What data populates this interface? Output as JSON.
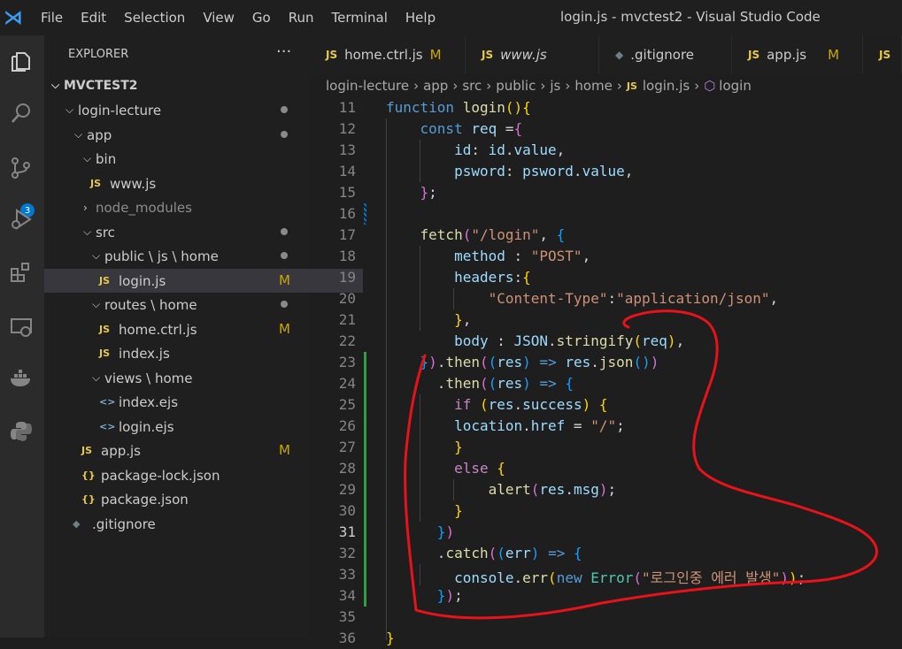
{
  "titlebar": {
    "menu": [
      "File",
      "Edit",
      "Selection",
      "View",
      "Go",
      "Run",
      "Terminal",
      "Help"
    ],
    "title": "login.js - mvctest2 - Visual Studio Code"
  },
  "activity": {
    "items": [
      "explorer-icon",
      "search-icon",
      "source-control-icon",
      "run-debug-icon",
      "extensions-icon",
      "remote-explorer-icon",
      "docker-icon",
      "python-icon"
    ],
    "source_control_badge": "3"
  },
  "explorer": {
    "title": "EXPLORER",
    "more": "···",
    "tree": [
      {
        "label": "MVCTEST2",
        "twisty": "⌵"
      },
      {
        "label": "login-lecture",
        "twisty": "⌵"
      },
      {
        "label": "app",
        "twisty": "⌵"
      },
      {
        "label": "bin",
        "twisty": "⌵"
      },
      {
        "label": "www.js",
        "icon": "JS"
      },
      {
        "label": "node_modules",
        "twisty": "›"
      },
      {
        "label": "src",
        "twisty": "⌵"
      },
      {
        "label": "public \\ js \\ home",
        "twisty": "⌵"
      },
      {
        "label": "login.js",
        "icon": "JS",
        "status": "M"
      },
      {
        "label": "routes \\ home",
        "twisty": "⌵"
      },
      {
        "label": "home.ctrl.js",
        "icon": "JS",
        "status": "M"
      },
      {
        "label": "index.js",
        "icon": "JS"
      },
      {
        "label": "views \\ home",
        "twisty": "⌵"
      },
      {
        "label": "index.ejs",
        "icon": "<>"
      },
      {
        "label": "login.ejs",
        "icon": "<>"
      },
      {
        "label": "app.js",
        "icon": "JS",
        "status": "M"
      },
      {
        "label": "package-lock.json",
        "icon": "{}"
      },
      {
        "label": "package.json",
        "icon": "{}"
      },
      {
        "label": ".gitignore",
        "icon": "◆"
      }
    ]
  },
  "tabs": [
    {
      "label": "home.ctrl.js",
      "icon": "JS",
      "status": "M"
    },
    {
      "label": "www.js",
      "icon": "JS"
    },
    {
      "label": ".gitignore",
      "icon": "◆"
    },
    {
      "label": "app.js",
      "icon": "JS",
      "status": "M"
    },
    {
      "label": "",
      "icon": "JS"
    }
  ],
  "breadcrumb": [
    "login-lecture",
    "app",
    "src",
    "public",
    "js",
    "home",
    "login.js",
    "login"
  ],
  "editor": {
    "line_numbers": [
      "11",
      "12",
      "13",
      "14",
      "15",
      "16",
      "17",
      "18",
      "19",
      "20",
      "21",
      "22",
      "23",
      "24",
      "25",
      "26",
      "27",
      "28",
      "29",
      "30",
      "31",
      "32",
      "33",
      "34",
      "35",
      "36"
    ],
    "lines": [
      "function login(){",
      "    const req ={",
      "        id: id.value,",
      "        psword: psword.value,",
      "    };",
      "",
      "    fetch(\"/login\", {",
      "        method : \"POST\",",
      "        headers:{",
      "            \"Content-Type\":\"application/json\",",
      "        },",
      "        body : JSON.stringify(req),",
      "    }).then((res) => res.json())",
      "      .then((res) => {",
      "        if (res.success) {",
      "        location.href = \"/\";",
      "        }",
      "        else {",
      "            alert(res.msg);",
      "        }",
      "      })",
      "      .catch((err) => {",
      "        console.err(new Error(\"로그인중 에러 발생\"));",
      "      });",
      "",
      "}"
    ]
  },
  "colors": {
    "accent": "#0078d4",
    "modified": "#cca700",
    "annotation": "#e8121a"
  }
}
